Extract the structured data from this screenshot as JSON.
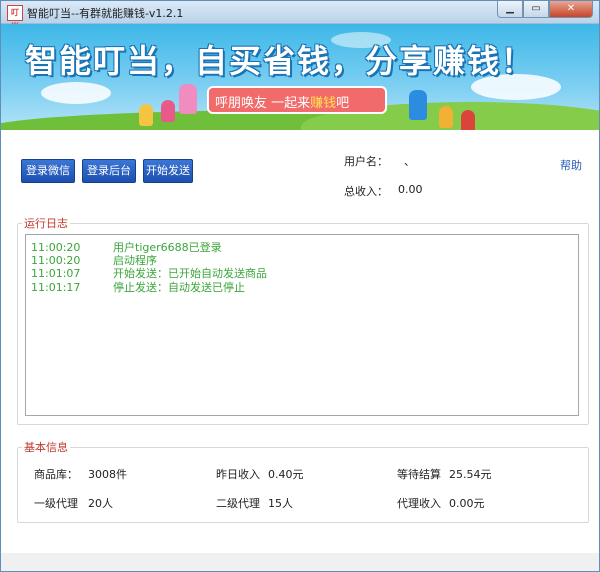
{
  "window": {
    "title": "智能叮当--有群就能赚钱-v1.2.1",
    "icon_text": "叮当",
    "controls": {
      "minimize": "▁",
      "maximize": "▭",
      "close": "✕"
    }
  },
  "banner": {
    "slogan": "智能叮当，自买省钱，分享赚钱！",
    "ribbon_part1": "呼朋唤友  一起来",
    "ribbon_highlight": "赚钱",
    "ribbon_part2": "吧"
  },
  "toolbar": {
    "login_wechat": "登录微信",
    "login_backend": "登录后台",
    "start_sending": "开始发送"
  },
  "account": {
    "username_label": "用户名：",
    "username_value": "、",
    "total_income_label": "总收入：",
    "total_income_value": "0.00",
    "help": "帮助"
  },
  "log": {
    "legend": "运行日志",
    "entries": [
      {
        "time": "11:00:20",
        "message": "用户tiger6688已登录"
      },
      {
        "time": "11:00:20",
        "message": "启动程序"
      },
      {
        "time": "11:01:07",
        "message": "开始发送：已开始自动发送商品"
      },
      {
        "time": "11:01:17",
        "message": "停止发送：自动发送已停止"
      }
    ]
  },
  "info": {
    "legend": "基本信息",
    "products_label": "商品库：",
    "products_value": "3008件",
    "yesterday_label": "昨日收入",
    "yesterday_value": "0.40元",
    "pending_label": "等待结算",
    "pending_value": "25.54元",
    "agent1_label": "一级代理",
    "agent1_value": "20人",
    "agent2_label": "二级代理",
    "agent2_value": "15人",
    "agent_income_label": "代理收入",
    "agent_income_value": "0.00元"
  },
  "colors": {
    "accent_button": "#1d4fb0",
    "legend_red": "#c0392b",
    "log_green": "#3aa53a",
    "banner_sky": "#3db7e8"
  }
}
